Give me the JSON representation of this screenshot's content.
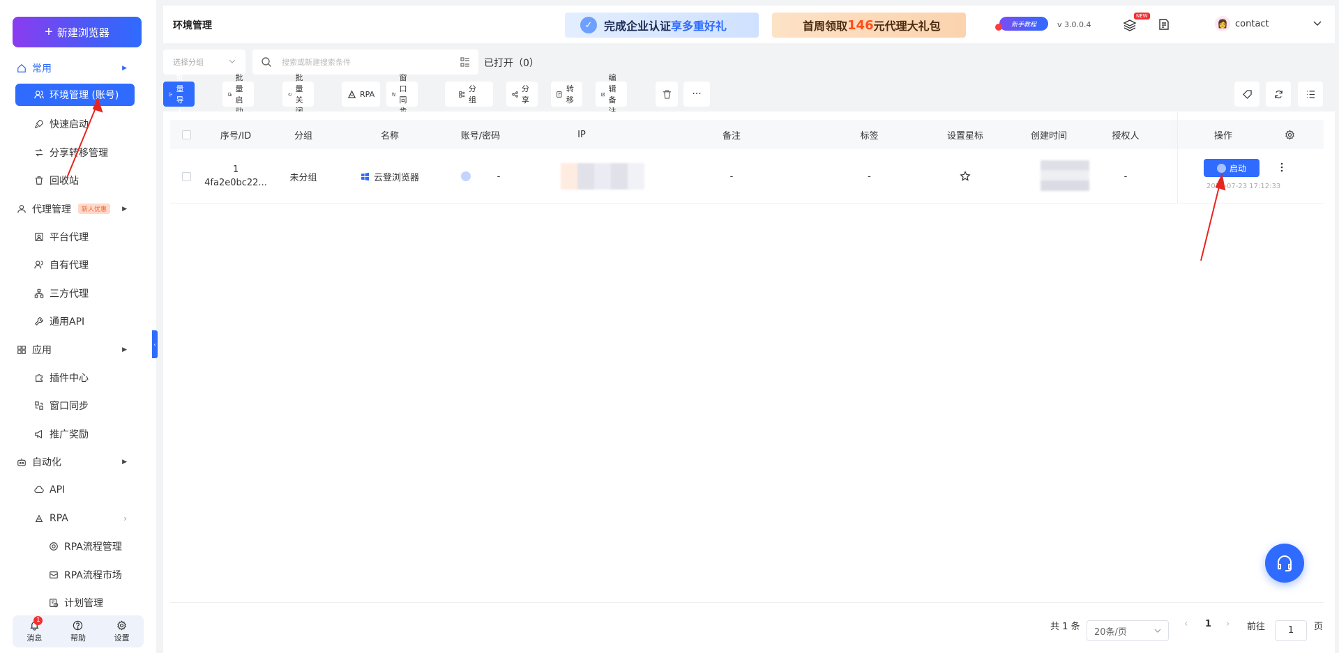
{
  "sidebar": {
    "new_browser_label": "新建浏览器",
    "groups": [
      {
        "label": "常用",
        "icon": "home-icon"
      },
      {
        "label": "代理管理",
        "badge": "新人优惠",
        "icon": "user-icon"
      },
      {
        "label": "应用",
        "icon": "grid-icon"
      },
      {
        "label": "自动化",
        "icon": "robot-icon"
      }
    ],
    "items": {
      "env_manage": "环境管理 (账号)",
      "quick_start": "快速启动",
      "share_transfer": "分享转移管理",
      "recycle_bin": "回收站",
      "platform_proxy": "平台代理",
      "own_proxy": "自有代理",
      "third_proxy": "三方代理",
      "general_api": "通用API",
      "plugin_center": "插件中心",
      "window_sync": "窗口同步",
      "promo_reward": "推广奖励",
      "api": "API",
      "rpa": "RPA",
      "rpa_flow_manage": "RPA流程管理",
      "rpa_flow_market": "RPA流程市场",
      "schedule_manage": "计划管理"
    },
    "bottom": {
      "messages_label": "消息",
      "messages_count": "1",
      "help_label": "帮助",
      "settings_label": "设置"
    }
  },
  "header": {
    "page_title": "环境管理",
    "banner1_text": "完成企业认证",
    "banner1_highlight": "享多重好礼",
    "banner2_prefix": "首周领取",
    "banner2_highlight": "146",
    "banner2_suffix": "元代理大礼包",
    "tutorial_label": "新手教程",
    "version": "v 3.0.0.4",
    "new_tag": "NEW",
    "username": "contact"
  },
  "filters": {
    "group_placeholder": "选择分组",
    "search_placeholder": "搜索或新建搜索条件",
    "opened_text": "已打开（0）"
  },
  "toolbar": {
    "batch_import": "批量导入",
    "batch_start": "批量启动",
    "batch_close": "批量关闭",
    "rpa": "RPA",
    "window_sync": "窗口同步",
    "group": "分组",
    "share": "分享",
    "transfer": "转移",
    "edit_note": "编辑备注"
  },
  "table": {
    "headers": {
      "id": "序号/ID",
      "group": "分组",
      "name": "名称",
      "account": "账号/密码",
      "ip": "IP",
      "note": "备注",
      "tag": "标签",
      "star": "设置星标",
      "created": "创建时间",
      "authorizer": "授权人",
      "ops": "操作"
    },
    "rows": [
      {
        "seq": "1",
        "id": "4fa2e0bc22...",
        "group": "未分组",
        "name": "云登浏览器",
        "account": "-",
        "note": "-",
        "tag": "-",
        "authorizer": "-",
        "start_label": "启动",
        "created_small": "2024-07-23 17:12:33"
      }
    ]
  },
  "pagination": {
    "total": "共 1 条",
    "page_size": "20条/页",
    "current_page": "1",
    "goto_label": "前往",
    "goto_value": "1",
    "page_suffix": "页"
  },
  "colors": {
    "primary": "#2f6bff",
    "annotation": "#e8241f"
  }
}
